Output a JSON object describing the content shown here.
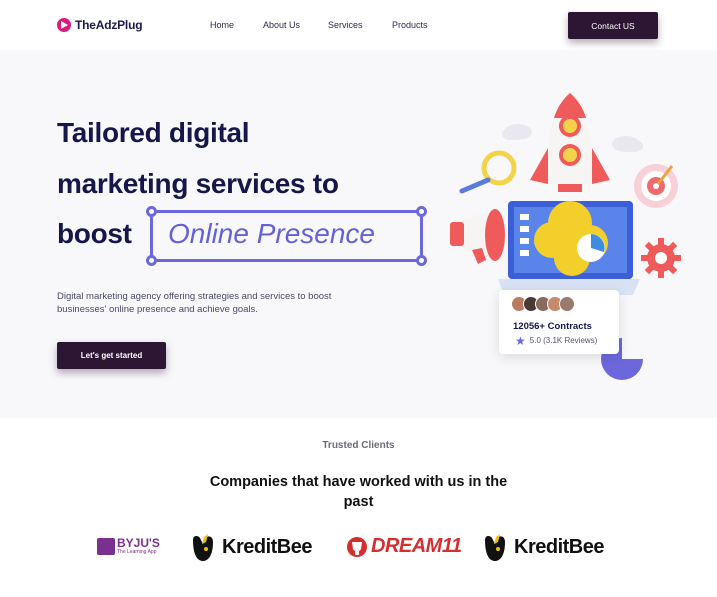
{
  "header": {
    "brand": "TheAdzPlug",
    "nav": [
      {
        "label": "Home"
      },
      {
        "label": "About Us"
      },
      {
        "label": "Services"
      },
      {
        "label": "Products"
      }
    ],
    "contact_label": "Contact US"
  },
  "hero": {
    "headline_line1": "Tailored digital",
    "headline_line2": "marketing services to",
    "headline_line3": "boost",
    "highlight": "Online Presence",
    "subtitle": "Digital marketing agency offering strategies and services to boost businesses' online presence and achieve goals.",
    "cta_label": "Let's get started",
    "accent_color": "#6c68dc"
  },
  "stats_card": {
    "contracts": "12056+ Contracts",
    "rating": "5.0 (3.1K Reviews)"
  },
  "clients": {
    "eyebrow": "Trusted Clients",
    "title": "Companies that have worked with us in the past",
    "logos": [
      {
        "name": "BYJU'S",
        "tagline": "The Learning App"
      },
      {
        "name": "KreditBee"
      },
      {
        "name": "DREAM11"
      },
      {
        "name": "KreditBee"
      }
    ]
  },
  "colors": {
    "primary_dark": "#2d1633",
    "navy_text": "#16164a",
    "brand_pink": "#d81b7c"
  }
}
